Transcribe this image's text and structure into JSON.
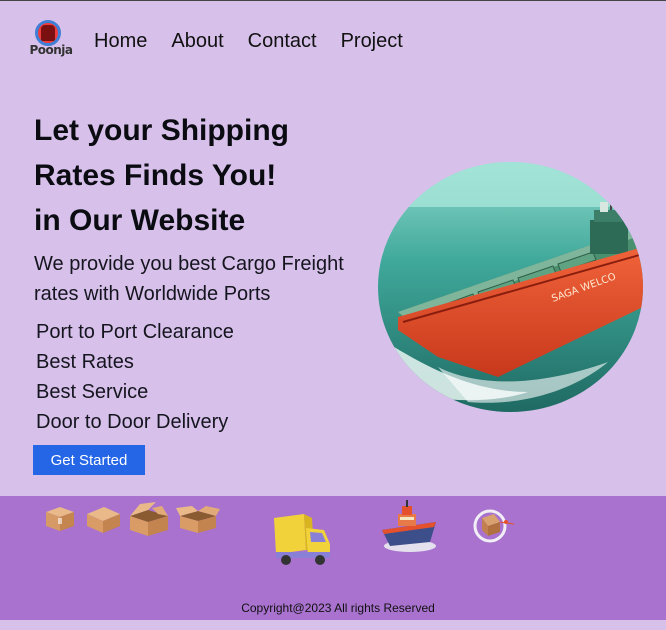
{
  "brand": {
    "logo_text": "Poonja"
  },
  "nav": {
    "items": [
      "Home",
      "About",
      "Contact",
      "Project"
    ]
  },
  "hero": {
    "headline_prefix": "Let ",
    "headline_bold": "your Shipping Rates Finds You!",
    "headline_suffix": "in Our Website",
    "subtext": "We provide you best Cargo Freight rates with Worldwide Ports",
    "features": [
      "Port to Port Clearance",
      "Best Rates",
      "Best Service",
      "Door to Door Delivery"
    ],
    "cta_label": "Get Started"
  },
  "hero_image": {
    "ship_name": "SAGA WELCO"
  },
  "footer": {
    "icons": [
      "cardboard-box-icon",
      "cardboard-box-icon",
      "open-box-icon",
      "open-box-icon",
      "delivery-truck-icon",
      "cargo-ship-icon",
      "package-cycle-icon"
    ],
    "copyright": "Copyright@2023 All rights Reserved"
  },
  "colors": {
    "background": "#d7c1ea",
    "footer": "#a872ce",
    "cta": "#2566e6",
    "hull": "#e4512c",
    "sea": "#3fa89a"
  }
}
